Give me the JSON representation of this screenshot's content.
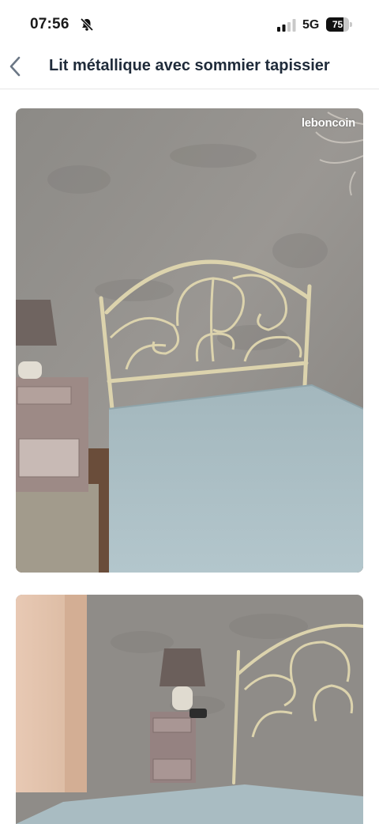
{
  "status_bar": {
    "time": "07:56",
    "network": "5G",
    "battery_level": "75",
    "icons": [
      "bell-slash-icon",
      "signal-bars-icon",
      "battery-icon"
    ]
  },
  "nav": {
    "back_icon": "chevron-left-icon",
    "title": "Lit métallique avec sommier tapissier"
  },
  "gallery": {
    "watermark": "leboncoin",
    "photo_count_visible": 2,
    "colors": {
      "wall": "#8f8c88",
      "mattress": "#a9bcc2",
      "headboard": "#dcd3ad"
    }
  }
}
